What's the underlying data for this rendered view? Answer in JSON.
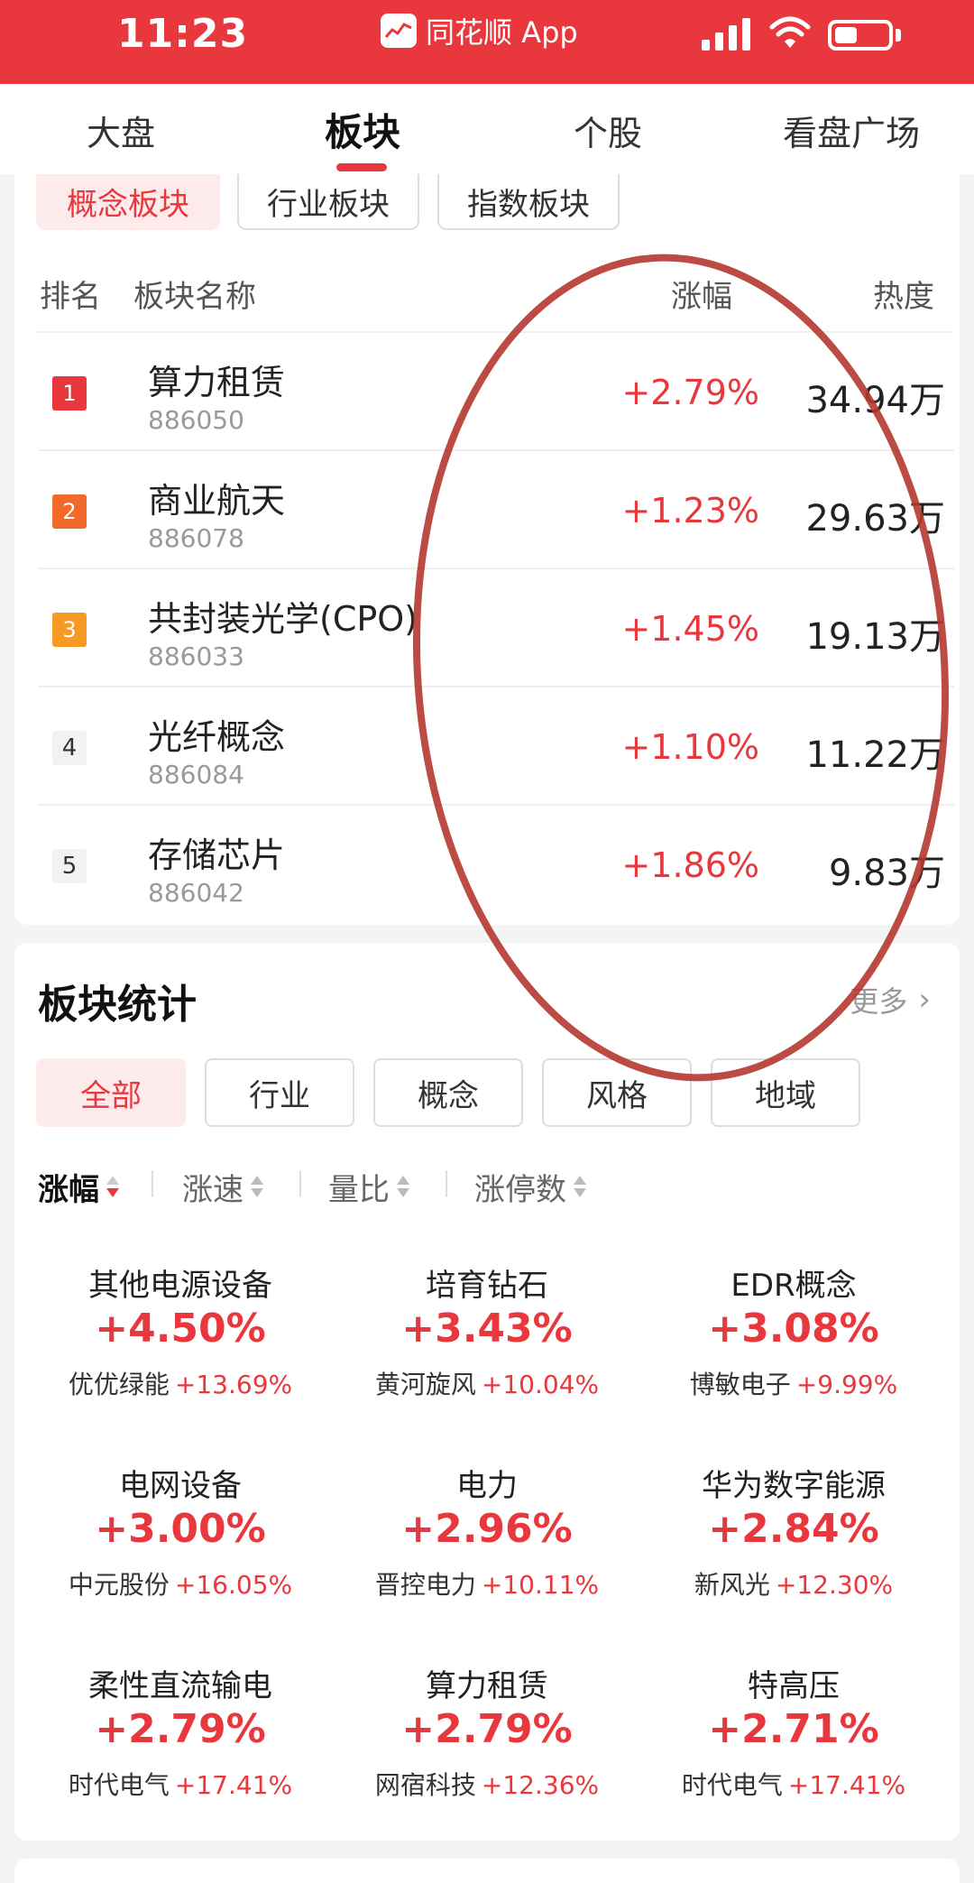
{
  "status_bar": {
    "time": "11:23",
    "app_name": "同花顺 App"
  },
  "top_tabs": [
    "大盘",
    "板块",
    "个股",
    "看盘广场"
  ],
  "sub_tabs": [
    "概念板块",
    "行业板块",
    "指数板块"
  ],
  "table": {
    "headers": {
      "rank": "排名",
      "name": "板块名称",
      "change": "涨幅",
      "heat": "热度"
    },
    "rows": [
      {
        "rank": "1",
        "name": "算力租赁",
        "code": "886050",
        "change": "+2.79%",
        "heat": "34.94万"
      },
      {
        "rank": "2",
        "name": "商业航天",
        "code": "886078",
        "change": "+1.23%",
        "heat": "29.63万"
      },
      {
        "rank": "3",
        "name": "共封装光学(CPO)",
        "code": "886033",
        "change": "+1.45%",
        "heat": "19.13万"
      },
      {
        "rank": "4",
        "name": "光纤概念",
        "code": "886084",
        "change": "+1.10%",
        "heat": "11.22万"
      },
      {
        "rank": "5",
        "name": "存储芯片",
        "code": "886042",
        "change": "+1.86%",
        "heat": "9.83万"
      }
    ]
  },
  "stats": {
    "title": "板块统计",
    "more": "更多",
    "filters": [
      "全部",
      "行业",
      "概念",
      "风格",
      "地域"
    ],
    "sorts": [
      "涨幅",
      "涨速",
      "量比",
      "涨停数"
    ],
    "cells": [
      {
        "name": "其他电源设备",
        "change": "+4.50%",
        "stock": "优优绿能",
        "stock_change": "+13.69%"
      },
      {
        "name": "培育钻石",
        "change": "+3.43%",
        "stock": "黄河旋风",
        "stock_change": "+10.04%"
      },
      {
        "name": "EDR概念",
        "change": "+3.08%",
        "stock": "博敏电子",
        "stock_change": "+9.99%"
      },
      {
        "name": "电网设备",
        "change": "+3.00%",
        "stock": "中元股份",
        "stock_change": "+16.05%"
      },
      {
        "name": "电力",
        "change": "+2.96%",
        "stock": "晋控电力",
        "stock_change": "+10.11%"
      },
      {
        "name": "华为数字能源",
        "change": "+2.84%",
        "stock": "新风光",
        "stock_change": "+12.30%"
      },
      {
        "name": "柔性直流输电",
        "change": "+2.79%",
        "stock": "时代电气",
        "stock_change": "+17.41%"
      },
      {
        "name": "算力租赁",
        "change": "+2.79%",
        "stock": "网宿科技",
        "stock_change": "+12.36%"
      },
      {
        "name": "特高压",
        "change": "+2.71%",
        "stock": "时代电气",
        "stock_change": "+17.41%"
      }
    ]
  },
  "colors": {
    "accent": "#e8383d",
    "rank1": "#e8383d",
    "rank2": "#f26a2a",
    "rank3": "#f59a23",
    "annotation": "#b5392f"
  }
}
